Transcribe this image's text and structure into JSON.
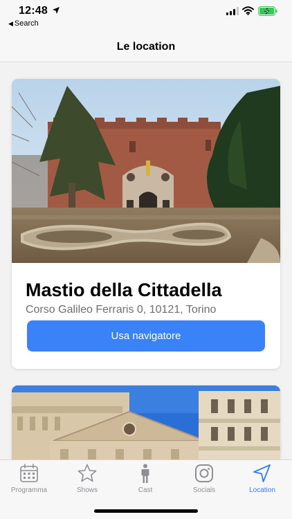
{
  "status_bar": {
    "time": "12:48",
    "back_label": "Search",
    "icons": [
      "location-arrow-icon",
      "cellular-signal-icon",
      "wifi-icon",
      "battery-charging-icon"
    ]
  },
  "nav": {
    "title": "Le location"
  },
  "locations": [
    {
      "name": "Mastio della Cittadella",
      "address": "Corso Galileo Ferraris 0, 10121, Torino",
      "button_label": "Usa navigatore"
    },
    {
      "name": "",
      "address": ""
    }
  ],
  "tab_bar": {
    "tabs": [
      {
        "label": "Programma",
        "icon": "calendar-icon"
      },
      {
        "label": "Shows",
        "icon": "star-icon"
      },
      {
        "label": "Cast",
        "icon": "person-icon"
      },
      {
        "label": "Socials",
        "icon": "instagram-icon"
      },
      {
        "label": "Location",
        "icon": "location-arrow-icon"
      }
    ],
    "active_index": 4
  },
  "colors": {
    "accent": "#3a82f7",
    "tab_active": "#2f7cf6",
    "tab_inactive": "#8e8e93",
    "battery": "#34c759"
  }
}
